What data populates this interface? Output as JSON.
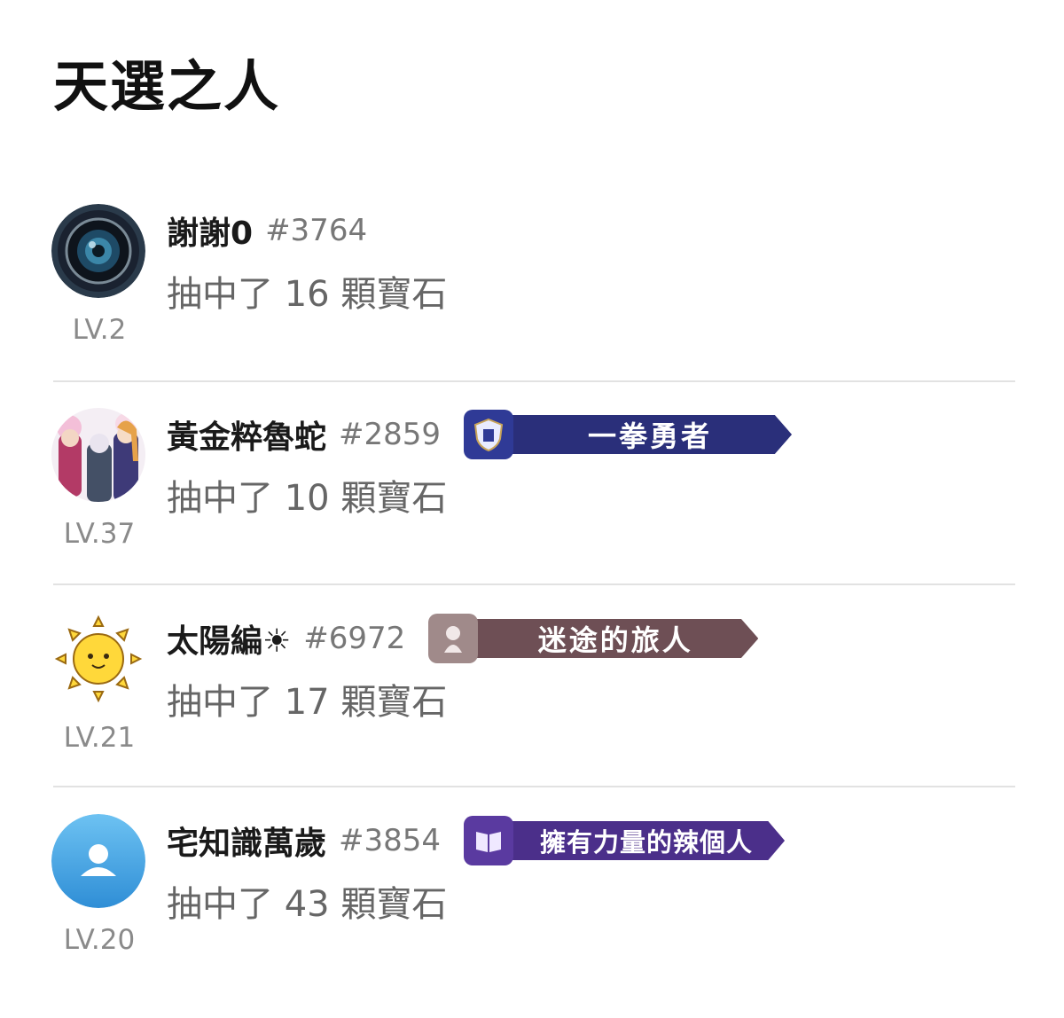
{
  "page": {
    "title": "天選之人"
  },
  "winners": [
    {
      "name": "謝謝0",
      "tag": "#3764",
      "level": "LV.2",
      "reward": "抽中了 16 顆寶石",
      "avatar_icon": "camera-lens-avatar",
      "badge": null
    },
    {
      "name": "黃金粹魯蛇",
      "tag": "#2859",
      "level": "LV.37",
      "reward": "抽中了 10 顆寶石",
      "avatar_icon": "anime-characters-avatar",
      "badge": {
        "label": "一拳勇者",
        "color": "#2a2f7a",
        "emblem_color": "#2f3a96",
        "icon": "shield-crest-icon"
      }
    },
    {
      "name": "太陽編☀",
      "tag": "#6972",
      "level": "LV.21",
      "reward": "抽中了 17 顆寶石",
      "avatar_icon": "smiling-sun-avatar",
      "badge": {
        "label": "迷途的旅人",
        "color": "#6e4f55",
        "emblem_color": "#a08a8a",
        "icon": "wanderer-icon"
      }
    },
    {
      "name": "宅知識萬歲",
      "tag": "#3854",
      "level": "LV.20",
      "reward": "抽中了 43 顆寶石",
      "avatar_icon": "default-user-avatar",
      "badge": {
        "label": "擁有力量的辣個人",
        "color": "#4b2f8a",
        "emblem_color": "#5a3aa0",
        "icon": "open-book-icon"
      }
    }
  ]
}
